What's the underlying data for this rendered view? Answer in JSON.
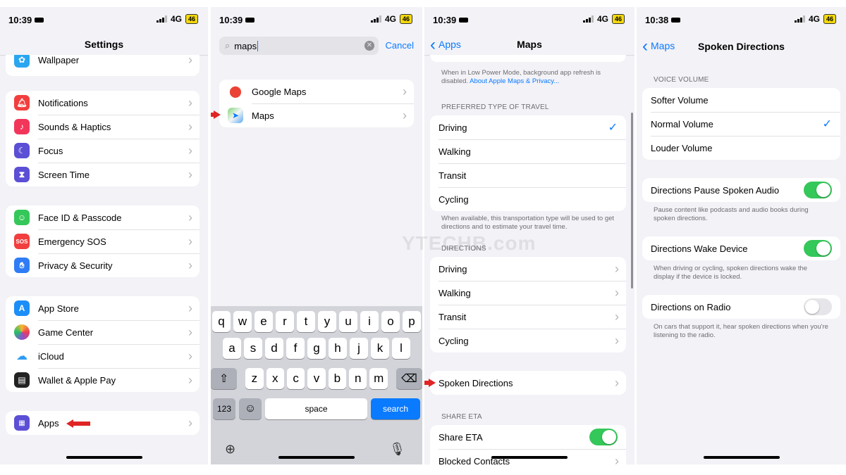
{
  "status": {
    "p1": {
      "time": "10:39",
      "net": "4G",
      "battery": "46"
    },
    "p2": {
      "time": "10:39",
      "net": "4G",
      "battery": "46"
    },
    "p3": {
      "time": "10:39",
      "net": "4G",
      "battery": "46"
    },
    "p4": {
      "time": "10:38",
      "net": "4G",
      "battery": "46"
    }
  },
  "settings": {
    "title": "Settings",
    "partial_top": {
      "label": "Wallpaper",
      "icon": "wallpaper-icon",
      "color": "#2aa6f0"
    },
    "group1": [
      {
        "label": "Notifications",
        "icon": "bell-icon",
        "color": "#f23e3e"
      },
      {
        "label": "Sounds & Haptics",
        "icon": "speaker-icon",
        "color": "#f2365a"
      },
      {
        "label": "Focus",
        "icon": "moon-icon",
        "color": "#5b4fd6"
      },
      {
        "label": "Screen Time",
        "icon": "hourglass-icon",
        "color": "#5b4fd6"
      }
    ],
    "group2": [
      {
        "label": "Face ID & Passcode",
        "icon": "face-id-icon",
        "color": "#34c759"
      },
      {
        "label": "Emergency SOS",
        "icon": "sos-icon",
        "color": "#f23e3e",
        "text": "SOS"
      },
      {
        "label": "Privacy & Security",
        "icon": "hand-icon",
        "color": "#2f7cf6"
      }
    ],
    "group3": [
      {
        "label": "App Store",
        "icon": "app-store-icon",
        "color": "#1c8ef7"
      },
      {
        "label": "Game Center",
        "icon": "game-center-icon",
        "color": "#f0f0f0"
      },
      {
        "label": "iCloud",
        "icon": "cloud-icon",
        "color": "#ffffff"
      },
      {
        "label": "Wallet & Apple Pay",
        "icon": "wallet-icon",
        "color": "#222222"
      }
    ],
    "group4": [
      {
        "label": "Apps",
        "icon": "apps-grid-icon",
        "color": "#5b4fd6"
      }
    ]
  },
  "search": {
    "query": "maps",
    "cancel": "Cancel",
    "results": [
      {
        "label": "Google Maps",
        "icon": "google-maps-icon"
      },
      {
        "label": "Maps",
        "icon": "apple-maps-icon"
      }
    ]
  },
  "keyboard": {
    "row1": [
      "q",
      "w",
      "e",
      "r",
      "t",
      "y",
      "u",
      "i",
      "o",
      "p"
    ],
    "row2": [
      "a",
      "s",
      "d",
      "f",
      "g",
      "h",
      "j",
      "k",
      "l"
    ],
    "row3": [
      "z",
      "x",
      "c",
      "v",
      "b",
      "n",
      "m"
    ],
    "numbers": "123",
    "space": "space",
    "go": "search"
  },
  "maps": {
    "back": "Apps",
    "title": "Maps",
    "low_power_note": "When in Low Power Mode, background app refresh is disabled.",
    "low_power_link": "About Apple Maps & Privacy...",
    "travel_header": "PREFERRED TYPE OF TRAVEL",
    "travel": [
      "Driving",
      "Walking",
      "Transit",
      "Cycling"
    ],
    "travel_selected": "Driving",
    "travel_note": "When available, this transportation type will be used to get directions and to estimate your travel time.",
    "directions_header": "DIRECTIONS",
    "directions": [
      "Driving",
      "Walking",
      "Transit",
      "Cycling"
    ],
    "spoken": "Spoken Directions",
    "share_header": "SHARE ETA",
    "share_eta": "Share ETA",
    "blocked": "Blocked Contacts"
  },
  "spoken": {
    "back": "Maps",
    "title": "Spoken Directions",
    "volume_header": "VOICE VOLUME",
    "volumes": [
      "Softer Volume",
      "Normal Volume",
      "Louder Volume"
    ],
    "volume_selected": "Normal Volume",
    "pause_label": "Directions Pause Spoken Audio",
    "pause_on": true,
    "pause_note": "Pause content like podcasts and audio books during spoken directions.",
    "wake_label": "Directions Wake Device",
    "wake_on": true,
    "wake_note": "When driving or cycling, spoken directions wake the display if the device is locked.",
    "radio_label": "Directions on Radio",
    "radio_on": false,
    "radio_note": "On cars that support it, hear spoken directions when you're listening to the radio."
  },
  "watermark": "YTECHB.com",
  "accent_color": "#0a7aff",
  "arrow_color": "#e02424"
}
